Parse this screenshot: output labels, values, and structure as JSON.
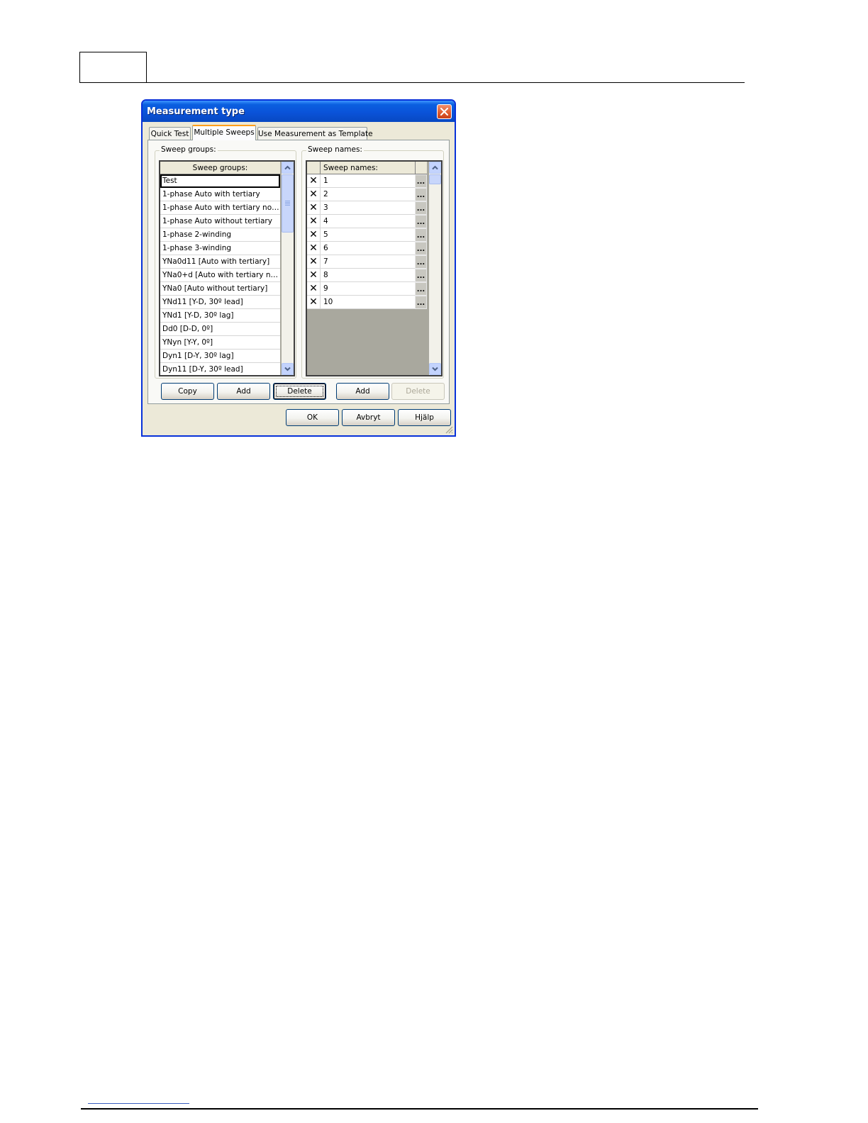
{
  "window": {
    "title": "Measurement type"
  },
  "tabs": [
    {
      "label": "Quick Test",
      "active": false
    },
    {
      "label": "Multiple Sweeps",
      "active": true
    },
    {
      "label": "Use Measurement as Template",
      "active": false
    }
  ],
  "sweep_groups": {
    "legend": "Sweep groups:",
    "header": "Sweep groups:",
    "rows": [
      "Test",
      "1-phase Auto with tertiary",
      "1-phase Auto with tertiary not f...",
      "1-phase Auto without tertiary",
      "1-phase 2-winding",
      "1-phase 3-winding",
      "YNa0d11 [Auto with tertiary]",
      "YNa0+d [Auto with tertiary not ...",
      "YNa0 [Auto without tertiary]",
      "YNd11 [Y-D, 30º lead]",
      "YNd1 [Y-D, 30º lag]",
      "Dd0 [D-D, 0º]",
      "YNyn [Y-Y, 0º]",
      "Dyn1 [D-Y, 30º lag]",
      "Dyn11 [D-Y, 30º lead]"
    ],
    "selected_index": 0
  },
  "sweep_names": {
    "legend": "Sweep names:",
    "header": "Sweep names:",
    "delete_glyph": "✕",
    "browse_glyph": "...",
    "rows": [
      "1",
      "2",
      "3",
      "4",
      "5",
      "6",
      "7",
      "8",
      "9",
      "10"
    ]
  },
  "buttons": {
    "copy": "Copy",
    "add_group": "Add",
    "delete_group": "Delete",
    "add_name": "Add",
    "delete_name": "Delete",
    "ok": "OK",
    "cancel": "Avbryt",
    "help": "Hjälp"
  },
  "icons": {
    "close": "close-icon",
    "scroll_up": "chevron-up-icon",
    "scroll_down": "chevron-down-icon",
    "resize": "resize-grip-icon"
  },
  "colors": {
    "title_bar": "#0a53d9",
    "close_button": "#e05a2a",
    "active_tab_accent": "#ff9f1a",
    "grid_empty": "#a9a89e",
    "dialog_face": "#ece9d8"
  }
}
